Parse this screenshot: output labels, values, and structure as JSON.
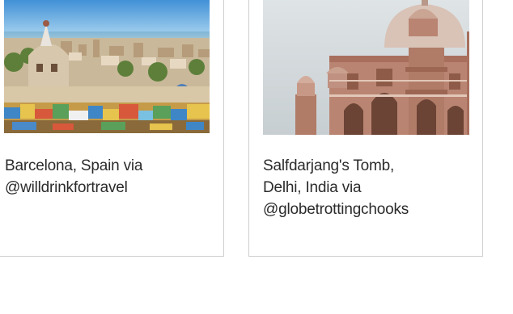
{
  "gallery": {
    "cards": [
      {
        "photo_alt": "Park Güell mosaic terrace overlooking Barcelona",
        "caption_lines": [
          "Barcelona, Spain via",
          "@willdrinkfortravel"
        ]
      },
      {
        "photo_alt": "Red sandstone tomb with domed towers",
        "caption_lines": [
          "Salfdarjang's Tomb,",
          "Delhi, India via",
          "@globetrottingchooks"
        ]
      }
    ]
  },
  "colors": {
    "border": "#cfcfcf",
    "text": "#2b2b2b",
    "sky_blue": "#5ea3d8",
    "sandstone": "#b98572"
  }
}
